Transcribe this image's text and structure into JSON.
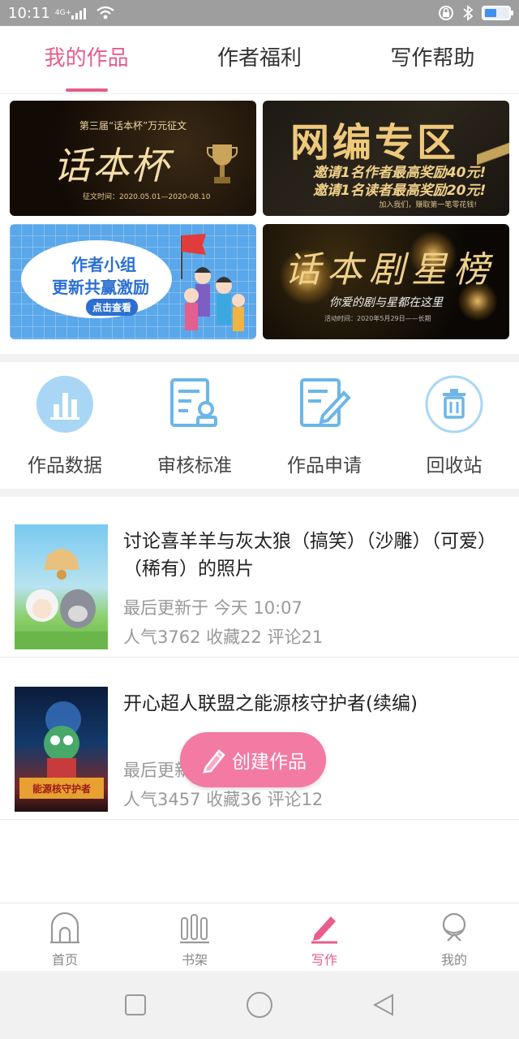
{
  "status_bar": {
    "time": "10:11",
    "network": "4G+"
  },
  "tabs": [
    {
      "label": "我的作品",
      "active": true
    },
    {
      "label": "作者福利",
      "active": false
    },
    {
      "label": "写作帮助",
      "active": false
    }
  ],
  "banners": {
    "b1": {
      "top": "第三届“话本杯”万元征文",
      "title": "话本杯",
      "date": "征文时间：2020.05.01—2020-08.10"
    },
    "b2": {
      "title": "网编专区",
      "line1": "邀请1名作者最高奖励40元!",
      "line2": "邀请1名读者最高奖励20元!",
      "footer": "加入我们，赚取第一笔零花钱!"
    },
    "b3": {
      "line1": "作者小组",
      "line2": "更新共赢激励",
      "button": "点击查看"
    },
    "b4": {
      "title": "话本剧星榜",
      "subtitle": "你爱的剧与星都在这里",
      "footer": "活动时间：2020年5月29日——长期"
    }
  },
  "actions": [
    {
      "label": "作品数据",
      "icon": "bar-chart-icon"
    },
    {
      "label": "审核标准",
      "icon": "review-doc-icon"
    },
    {
      "label": "作品申请",
      "icon": "edit-doc-icon"
    },
    {
      "label": "回收站",
      "icon": "trash-icon"
    }
  ],
  "works": [
    {
      "title": "讨论喜羊羊与灰太狼（搞笑）（沙雕）（可爱）（稀有）的照片",
      "updated": "最后更新于 今天 10:07",
      "stats": "人气3762 收藏22 评论21"
    },
    {
      "title": "开心超人联盟之能源核守护者(续编)",
      "updated": "最后更新于 今天 10:07",
      "stats": "人气3457 收藏36 评论12",
      "cover_text": "能源核守护者"
    }
  ],
  "fab": {
    "label": "创建作品"
  },
  "bottom_nav": [
    {
      "label": "首页",
      "icon": "home-icon",
      "active": false
    },
    {
      "label": "书架",
      "icon": "bookshelf-icon",
      "active": false
    },
    {
      "label": "写作",
      "icon": "pen-icon",
      "active": true
    },
    {
      "label": "我的",
      "icon": "profile-icon",
      "active": false
    }
  ],
  "colors": {
    "accent": "#e85d8a",
    "fab": "#f27aa3",
    "icon_blue": "#6cb6e8"
  }
}
